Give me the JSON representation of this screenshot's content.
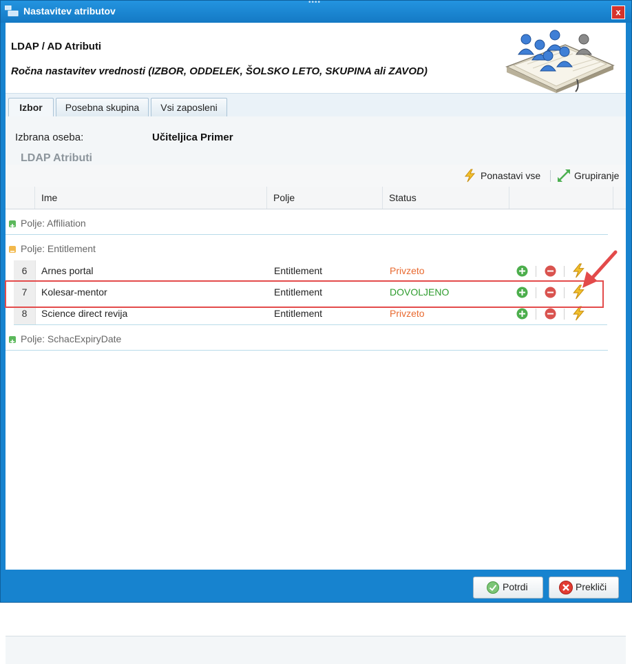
{
  "window": {
    "title": "Nastavitev atributov",
    "close_glyph": "x",
    "grip": "••••"
  },
  "header": {
    "title": "LDAP / AD Atributi",
    "subtitle": "Ročna nastavitev vrednosti (IZBOR, ODDELEK, ŠOLSKO LETO, SKUPINA ali ZAVOD)",
    "logo_icon": "users-book-icon"
  },
  "tabs": [
    {
      "label": "Izbor",
      "active": true
    },
    {
      "label": "Posebna skupina",
      "active": false
    },
    {
      "label": "Vsi zaposleni",
      "active": false
    }
  ],
  "person": {
    "label": "Izbrana oseba:",
    "name": "Učiteljica Primer"
  },
  "section_title": "LDAP Atributi",
  "toolbar": {
    "reset_all": "Ponastavi vse",
    "grouping": "Grupiranje"
  },
  "columns": [
    "Ime",
    "Polje",
    "Status"
  ],
  "groups": [
    {
      "label": "Polje: Affiliation",
      "expanded": false
    },
    {
      "label": "Polje: Entitlement",
      "expanded": true
    },
    {
      "label": "Polje: SchacExpiryDate",
      "expanded": false
    }
  ],
  "rows": [
    {
      "num": "6",
      "name": "Arnes portal",
      "field": "Entitlement",
      "status": "Privzeto"
    },
    {
      "num": "7",
      "name": "Kolesar-mentor",
      "field": "Entitlement",
      "status": "DOVOLJENO"
    },
    {
      "num": "8",
      "name": "Science direct revija",
      "field": "Entitlement",
      "status": "Privzeto"
    }
  ],
  "colors": {
    "status_default": "#e8692f",
    "status_allowed": "#2d9b2d",
    "window_frame": "#1783cf",
    "highlight": "#e34a4a"
  },
  "footer": {
    "confirm": "Potrdi",
    "cancel": "Prekliči"
  }
}
